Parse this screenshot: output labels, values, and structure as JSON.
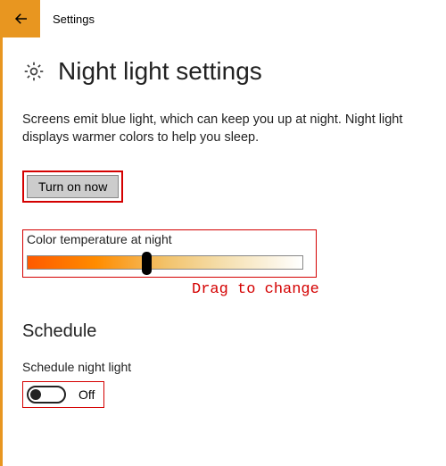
{
  "app": {
    "title": "Settings"
  },
  "page": {
    "title": "Night light settings",
    "description": "Screens emit blue light, which can keep you up at night. Night light displays warmer colors to help you sleep."
  },
  "turnOn": {
    "label": "Turn on now"
  },
  "slider": {
    "label": "Color temperature at night",
    "hint": "Drag to change",
    "value_percent": 42
  },
  "schedule": {
    "heading": "Schedule",
    "toggle_label": "Schedule night light",
    "toggle_state": "Off"
  },
  "colors": {
    "accent": "#E89620",
    "annotation": "#d40000"
  }
}
